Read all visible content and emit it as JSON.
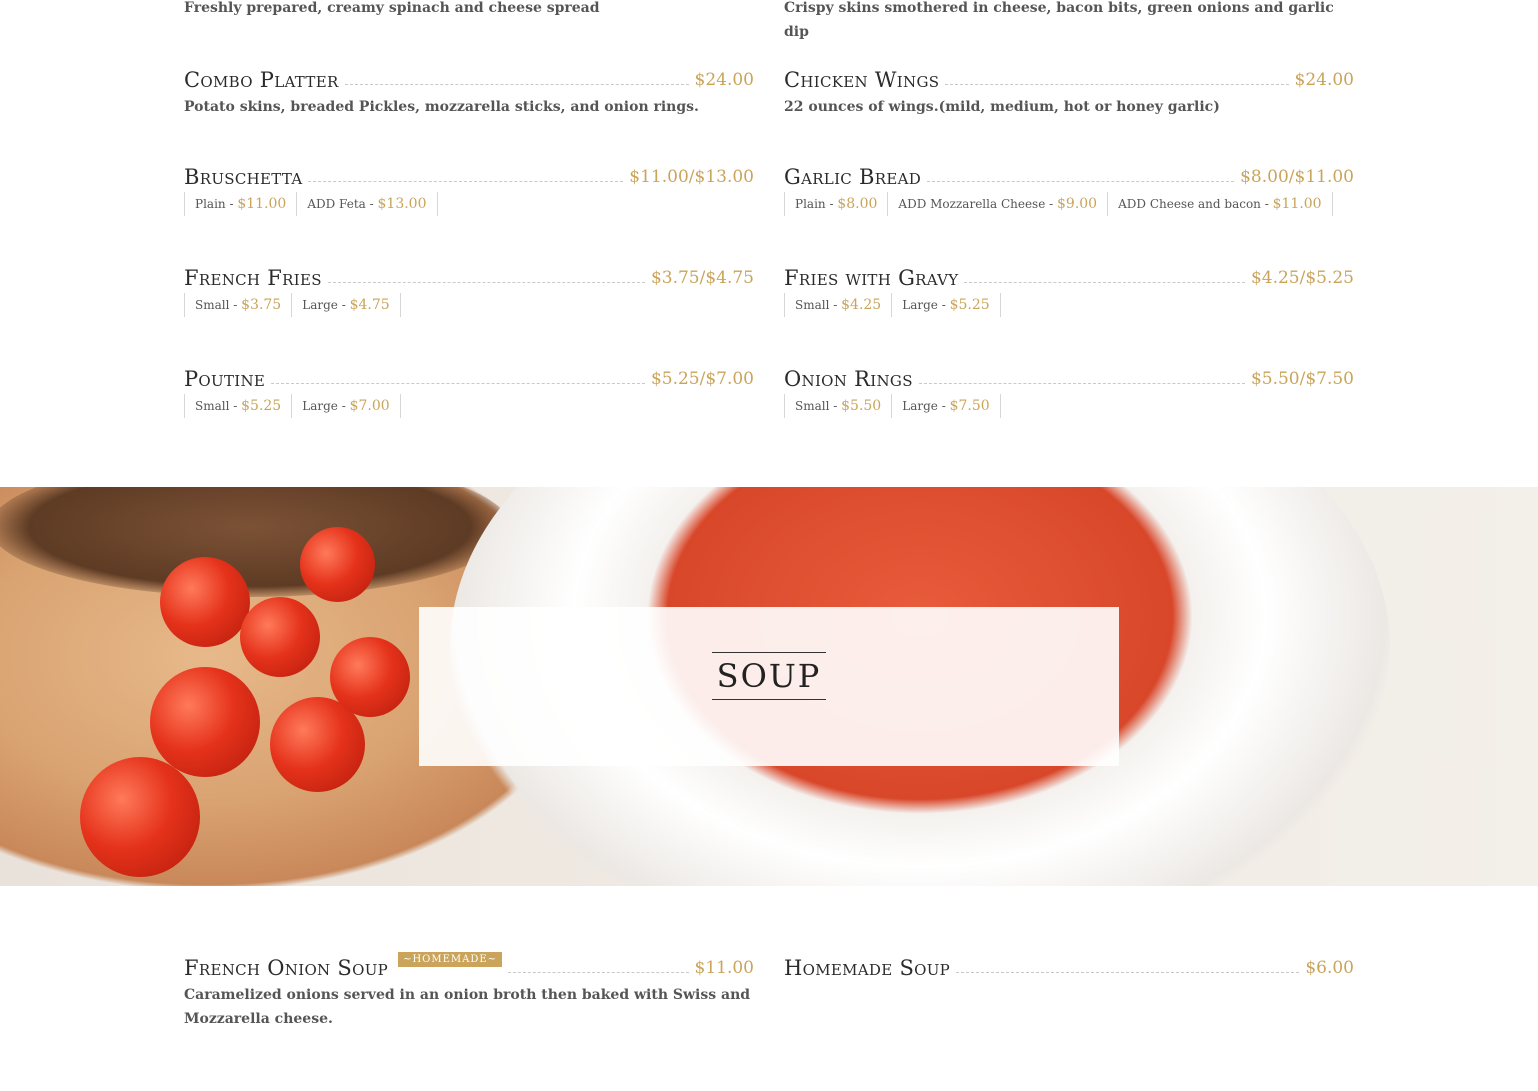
{
  "appetizers": {
    "spinach_dip": {
      "desc": "Freshly prepared, creamy spinach and cheese spread"
    },
    "potato_skins": {
      "desc": "Crispy skins smothered in cheese, bacon bits, green onions and garlic dip"
    },
    "combo_platter": {
      "name": "Combo Platter",
      "price": "$24.00",
      "desc": "Potato skins, breaded Pickles, mozzarella sticks, and onion rings."
    },
    "chicken_wings": {
      "name": "Chicken Wings",
      "price": "$24.00",
      "desc": "22 ounces of wings.(mild, medium, hot or honey garlic)"
    },
    "bruschetta": {
      "name": "Bruschetta",
      "price": "$11.00/$13.00",
      "options": [
        {
          "label": "Plain",
          "price": "$11.00"
        },
        {
          "label": "ADD Feta",
          "price": "$13.00"
        }
      ]
    },
    "garlic_bread": {
      "name": "Garlic Bread",
      "price": "$8.00/$11.00",
      "options": [
        {
          "label": "Plain",
          "price": "$8.00"
        },
        {
          "label": "ADD Mozzarella Cheese",
          "price": "$9.00"
        },
        {
          "label": "ADD Cheese and bacon",
          "price": "$11.00"
        }
      ]
    },
    "french_fries": {
      "name": "French Fries",
      "price": "$3.75/$4.75",
      "options": [
        {
          "label": "Small",
          "price": "$3.75"
        },
        {
          "label": "Large",
          "price": "$4.75"
        }
      ]
    },
    "fries_gravy": {
      "name": "Fries with Gravy",
      "price": "$4.25/$5.25",
      "options": [
        {
          "label": "Small",
          "price": "$4.25"
        },
        {
          "label": "Large",
          "price": "$5.25"
        }
      ]
    },
    "poutine": {
      "name": "Poutine",
      "price": "$5.25/$7.00",
      "options": [
        {
          "label": "Small",
          "price": "$5.25"
        },
        {
          "label": "Large",
          "price": "$7.00"
        }
      ]
    },
    "onion_rings": {
      "name": "Onion Rings",
      "price": "$5.50/$7.50",
      "options": [
        {
          "label": "Small",
          "price": "$5.50"
        },
        {
          "label": "Large",
          "price": "$7.50"
        }
      ]
    }
  },
  "soup_section": {
    "title": "SOUP"
  },
  "soups": {
    "french_onion": {
      "name": "French Onion Soup",
      "badge": "~HOMEMADE~",
      "price": "$11.00",
      "desc": "Caramelized onions served in an onion broth then baked with Swiss and Mozzarella cheese."
    },
    "homemade": {
      "name": "Homemade Soup",
      "price": "$6.00"
    }
  },
  "colors": {
    "accent": "#c9a45a",
    "text": "#333333"
  }
}
